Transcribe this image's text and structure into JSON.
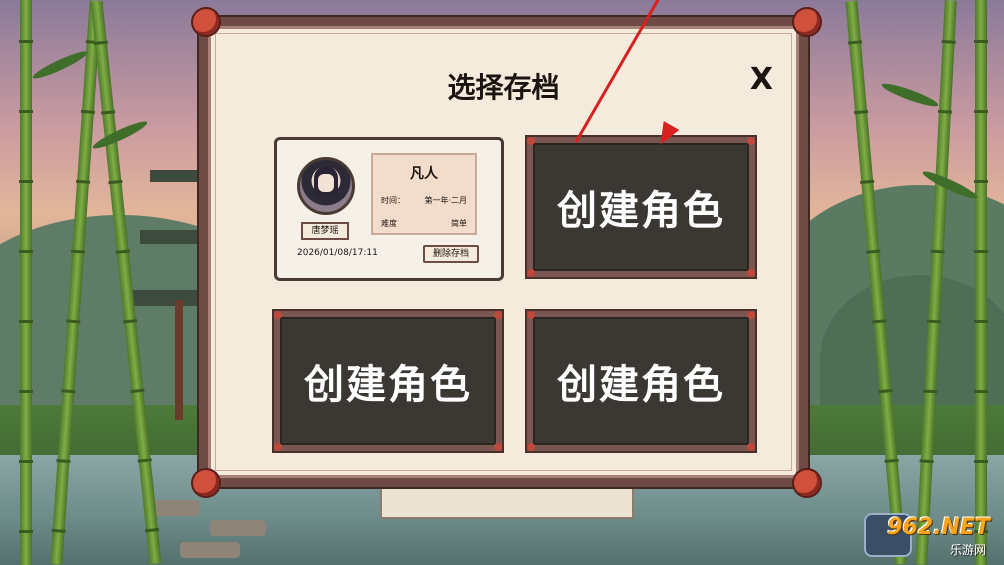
{
  "dialog": {
    "title": "选择存档",
    "close_label": "X"
  },
  "save_slot": {
    "character_name": "唐梦瑶",
    "rank": "凡人",
    "time_label": "时间：",
    "time_value": "第一年·二月",
    "difficulty_label": "难度",
    "difficulty_value": "简单",
    "saved_at": "2026/01/08/17:11",
    "delete_label": "删除存档"
  },
  "empty_slots": [
    {
      "label": "创建角色"
    },
    {
      "label": "创建角色"
    },
    {
      "label": "创建角色"
    }
  ],
  "watermark": {
    "main": "962.NET",
    "sub": "乐游网"
  },
  "colors": {
    "frame": "#6e4b45",
    "panel": "#f4ebdc",
    "empty_slot": "#3b3834",
    "accent_red": "#d8201e",
    "watermark_orange": "#f7a51e"
  }
}
